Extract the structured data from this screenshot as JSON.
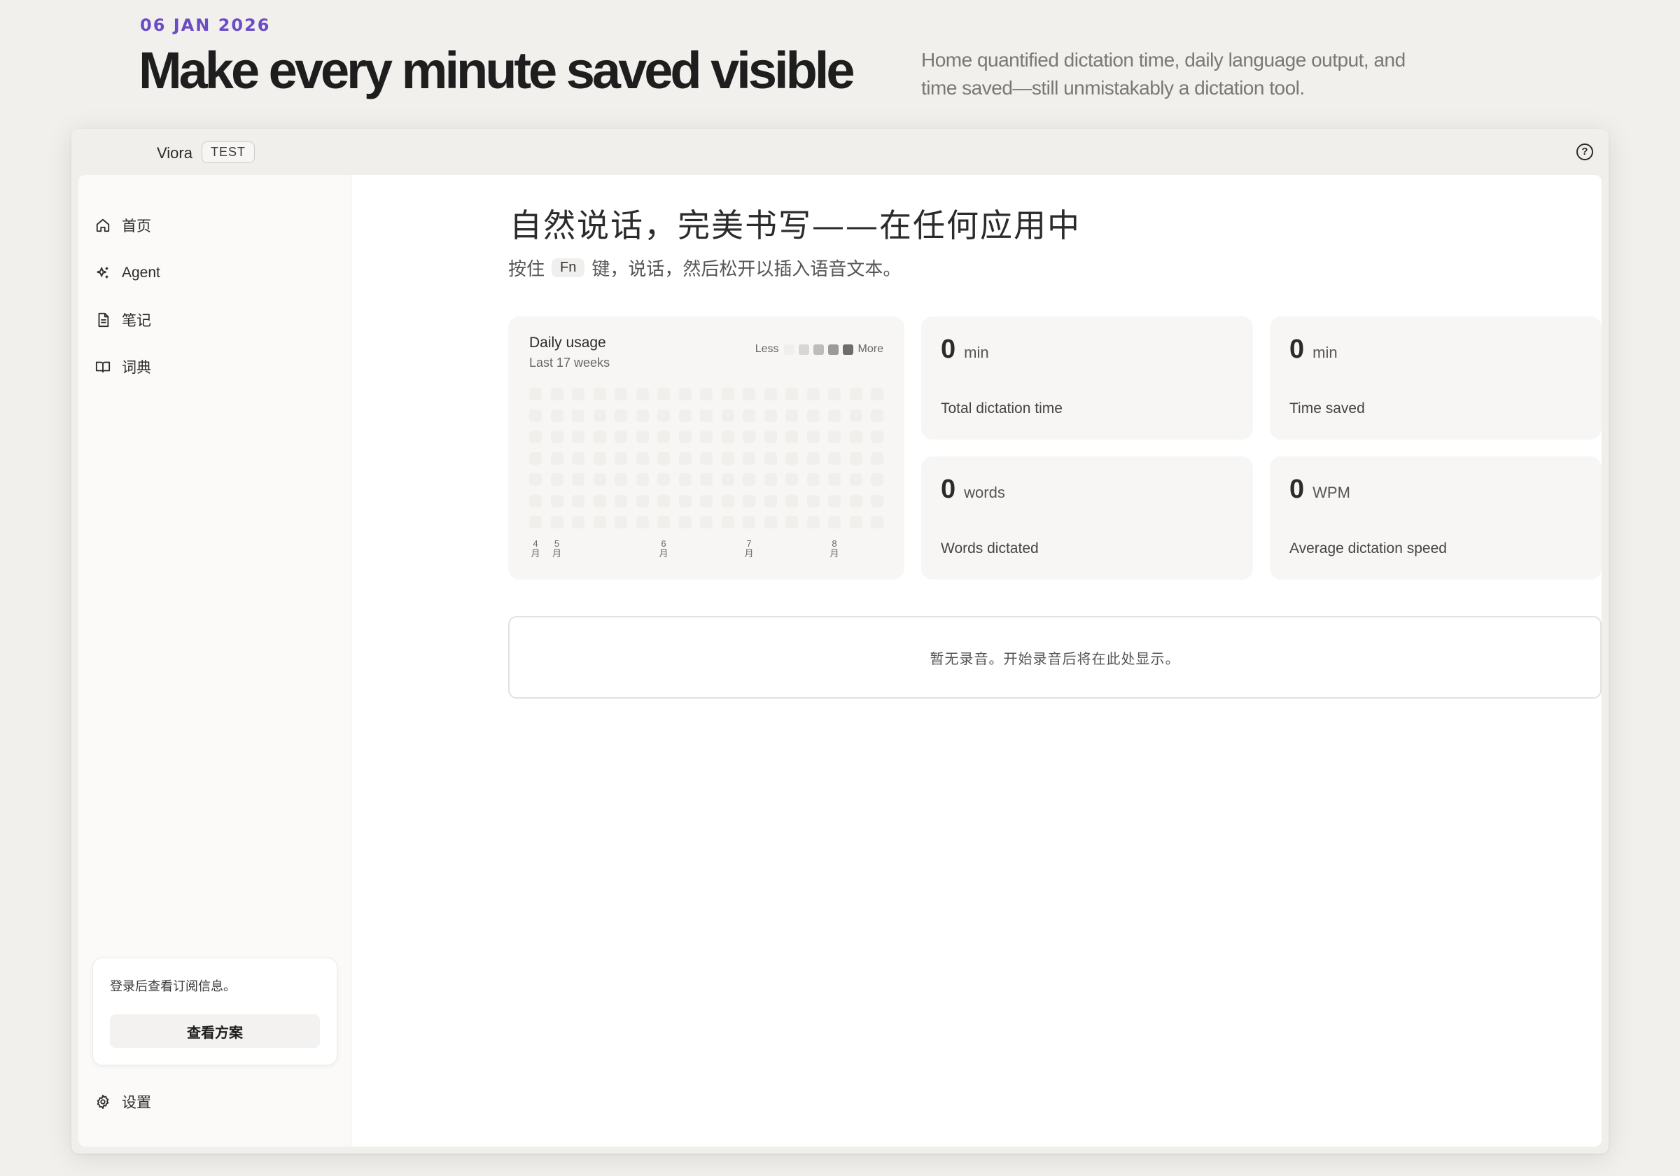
{
  "hero": {
    "date": "06 JAN 2026",
    "title": "Make every minute saved visible",
    "subtitle": "Home quantified dictation time, daily language output, and time saved—still unmistakably a dictation tool."
  },
  "app": {
    "name": "Viora",
    "badge": "TEST"
  },
  "sidebar": {
    "items": [
      {
        "label": "首页",
        "icon": "home-icon"
      },
      {
        "label": "Agent",
        "icon": "sparkles-icon"
      },
      {
        "label": "笔记",
        "icon": "document-icon"
      },
      {
        "label": "词典",
        "icon": "book-icon"
      }
    ],
    "subscription_text": "登录后查看订阅信息。",
    "plans_button": "查看方案",
    "settings_label": "设置"
  },
  "main": {
    "title": "自然说话，完美书写——在任何应用中",
    "sub_prefix": "按住",
    "key": "Fn",
    "sub_suffix": "键，说话，然后松开以插入语音文本。"
  },
  "heatmap": {
    "title": "Daily usage",
    "subtitle": "Last 17 weeks",
    "legend_less": "Less",
    "legend_more": "More",
    "legend_colors": [
      "#f1efec",
      "#d9d7d4",
      "#bebcb9",
      "#9c9a97",
      "#6f6d6b"
    ],
    "weeks": 17,
    "days": 7,
    "month_labels": [
      {
        "top": "4",
        "bottom": "月",
        "week": 0
      },
      {
        "top": "5",
        "bottom": "月",
        "week": 1
      },
      {
        "top": "6",
        "bottom": "月",
        "week": 6
      },
      {
        "top": "7",
        "bottom": "月",
        "week": 10
      },
      {
        "top": "8",
        "bottom": "月",
        "week": 14
      }
    ]
  },
  "stats": [
    {
      "value": "0",
      "unit": "min",
      "label": "Total dictation time"
    },
    {
      "value": "0",
      "unit": "min",
      "label": "Time saved"
    },
    {
      "value": "0",
      "unit": "words",
      "label": "Words dictated"
    },
    {
      "value": "0",
      "unit": "WPM",
      "label": "Average dictation speed"
    }
  ],
  "recordings": {
    "empty_text": "暂无录音。开始录音后将在此处显示。"
  }
}
